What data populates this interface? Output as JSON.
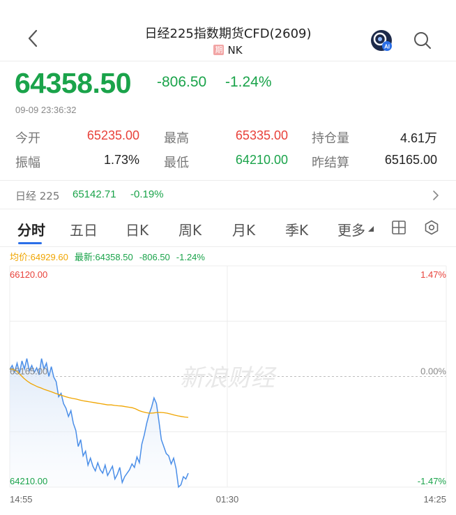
{
  "header": {
    "title": "日经225指数期货CFD(2609)",
    "tag": "期",
    "code": "NK"
  },
  "quote": {
    "price": "64358.50",
    "change": "-806.50",
    "change_pct": "-1.24%",
    "time": "09-09 23:36:32"
  },
  "stats": {
    "open_label": "今开",
    "open": "65235.00",
    "high_label": "最高",
    "high": "65335.00",
    "oi_label": "持仓量",
    "oi": "4.61万",
    "amp_label": "振幅",
    "amp": "1.73%",
    "low_label": "最低",
    "low": "64210.00",
    "settle_label": "昨结算",
    "settle": "65165.00"
  },
  "index": {
    "name": "日经 225",
    "value": "65142.71",
    "pct": "-0.19%"
  },
  "tabs": [
    "分时",
    "五日",
    "日K",
    "周K",
    "月K",
    "季K",
    "更多"
  ],
  "legend": {
    "avg": "均价:64929.60",
    "latest": "最新:64358.50",
    "change": "-806.50",
    "pct": "-1.24%"
  },
  "watermark": "新浪财经",
  "colors": {
    "up": "#e8413a",
    "down": "#1aa34a",
    "avg_line": "#f0a500",
    "price_line": "#4a8ee8",
    "accent": "#2b6fe8"
  },
  "chart_data": {
    "type": "line",
    "y_ticks_left": [
      "66120.00",
      "65165.00",
      "64210.00"
    ],
    "y_ticks_right": [
      "1.47%",
      "0.00%",
      "-1.47%"
    ],
    "x_ticks": [
      "14:55",
      "01:30",
      "14:25"
    ],
    "ylim": [
      64210,
      66120
    ],
    "reference": 65165,
    "series": [
      {
        "values": [
          65225,
          65260,
          65205,
          65280,
          65195,
          65300,
          65230,
          65320,
          65215,
          65260,
          65200,
          65240,
          65180,
          65320,
          65230,
          65280,
          65165,
          65250,
          65160,
          65120,
          64990,
          65020,
          64930,
          64890,
          64820,
          64870,
          64760,
          64700,
          64560,
          64620,
          64480,
          64520,
          64400,
          64460,
          64390,
          64350,
          64420,
          64360,
          64330,
          64400,
          64310,
          64350,
          64390,
          64280,
          64320,
          64380,
          64250,
          64300,
          64330,
          64360,
          64410,
          64380,
          64470,
          64420,
          64580,
          64660,
          64760,
          64840,
          64900,
          64980,
          64930,
          64780,
          64620,
          64560,
          64500,
          64480,
          64410,
          64460,
          64370,
          64210,
          64230,
          64300,
          64280,
          64330
        ]
      },
      {
        "values": [
          65230,
          65225,
          65210,
          65180,
          65150,
          65125,
          65105,
          65090,
          65075,
          65065,
          65052,
          65042,
          65032,
          65020,
          65010,
          65000,
          64990,
          64982,
          64975,
          64970,
          64962,
          64955,
          64950,
          64945,
          64940,
          64935,
          64930,
          64925,
          64920,
          64920,
          64915,
          64912,
          64910,
          64905,
          64900,
          64895,
          64885,
          64870,
          64860,
          64852,
          64848,
          64850,
          64854,
          64855,
          64852,
          64848,
          64840,
          64832,
          64825,
          64820,
          64815,
          64812
        ]
      }
    ]
  }
}
